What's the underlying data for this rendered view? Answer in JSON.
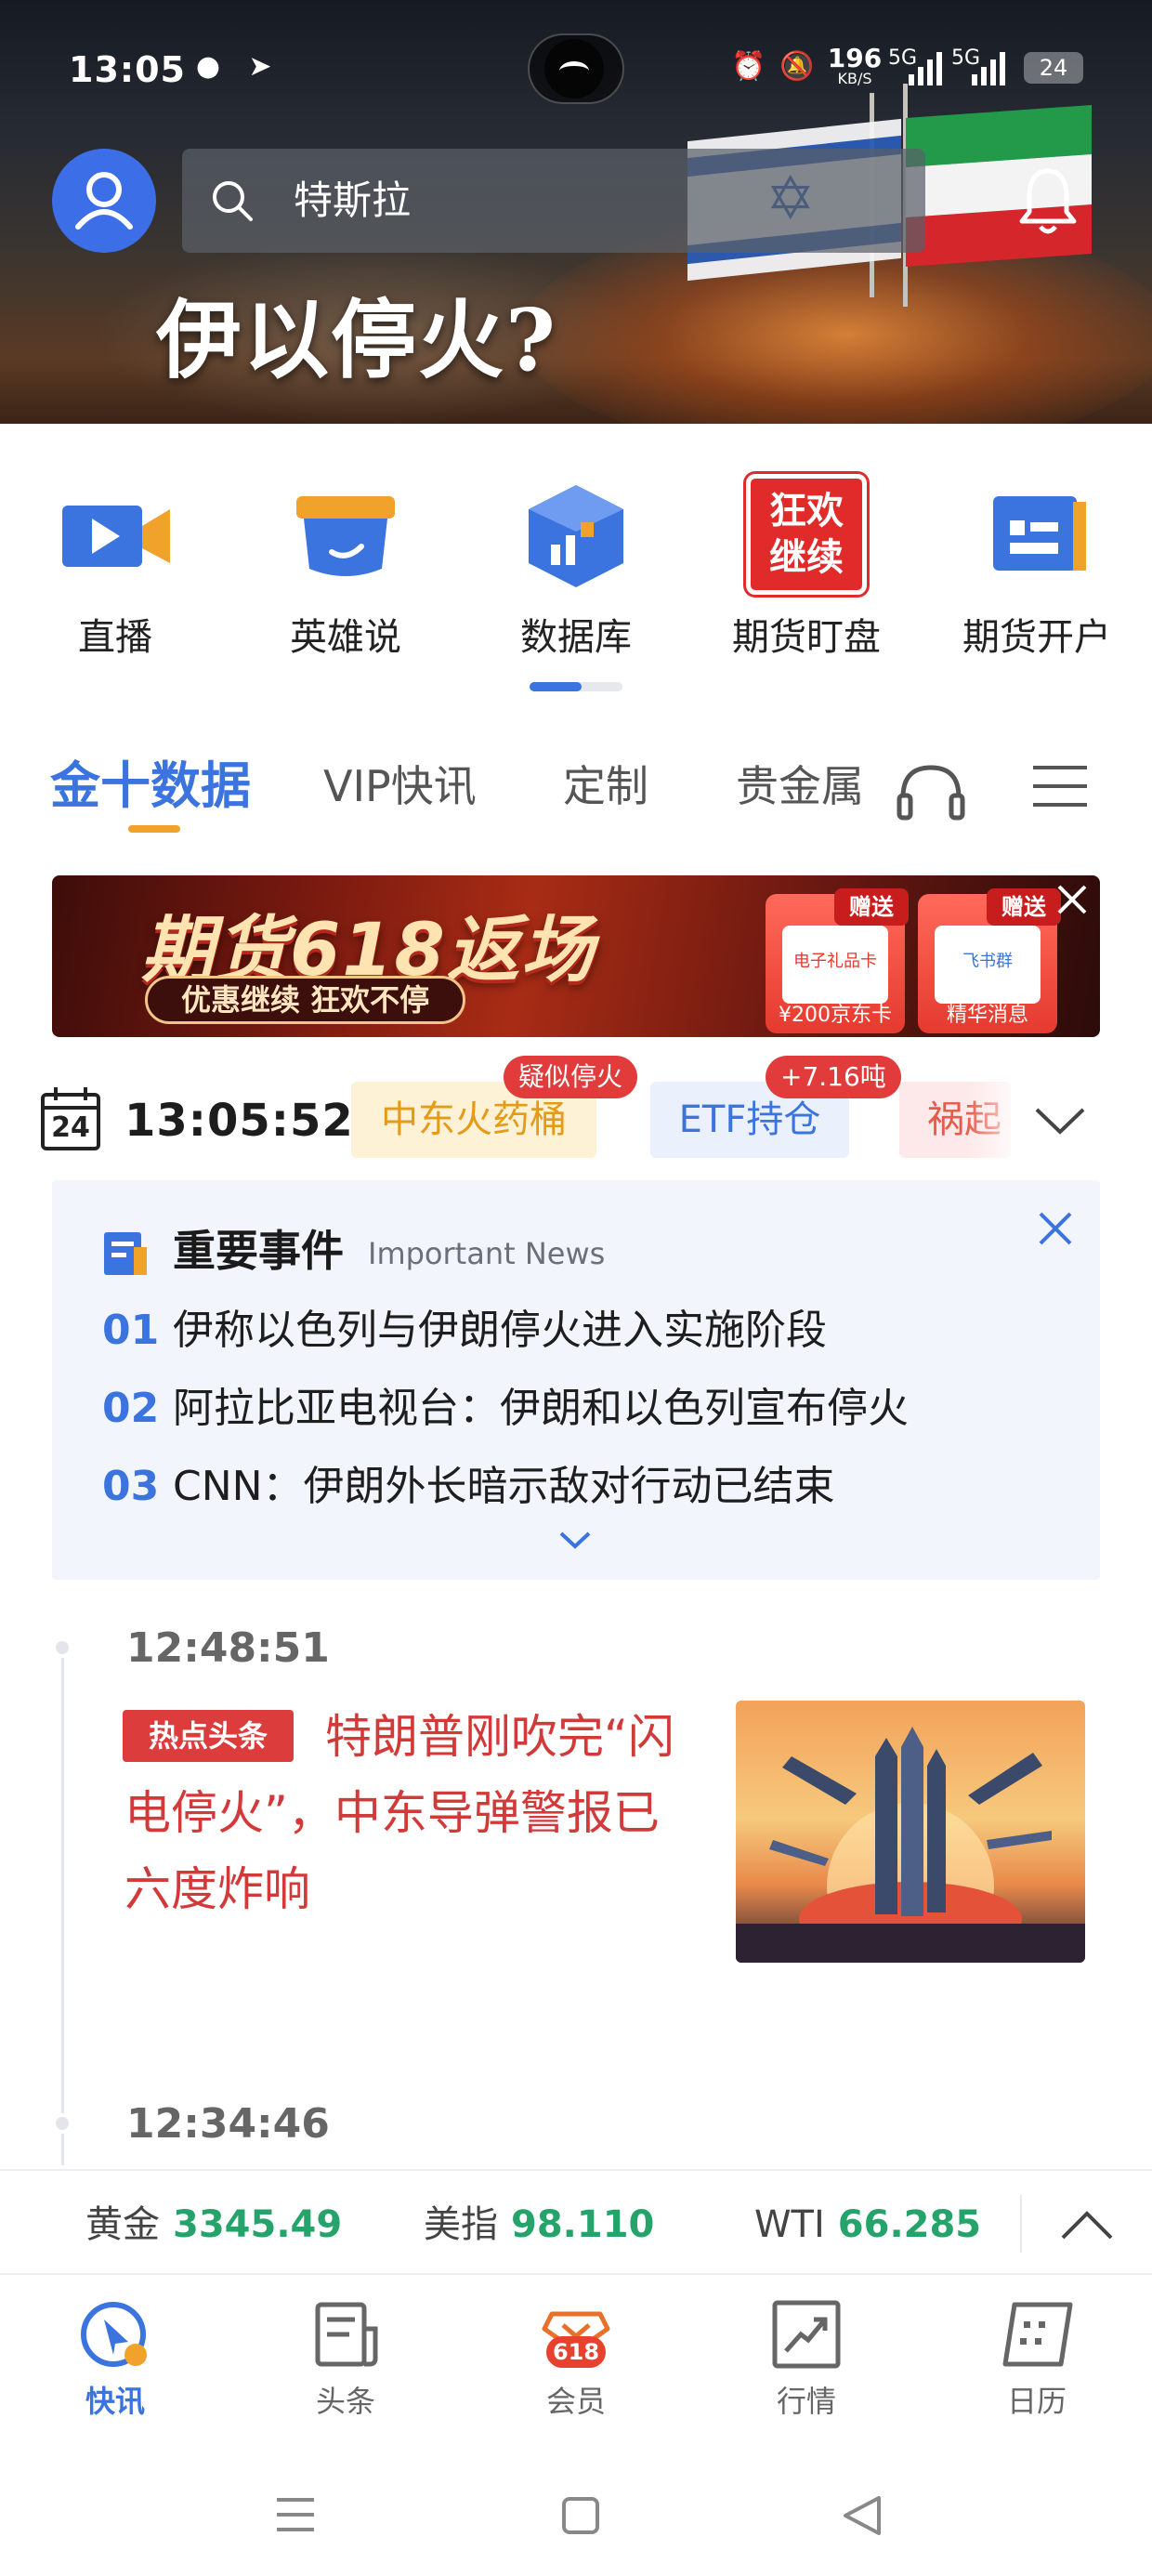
{
  "status_bar": {
    "time": "13:05",
    "net_speed_value": "196",
    "net_speed_unit": "KB/S",
    "signal_1": "5G",
    "signal_2": "5G",
    "battery": "24"
  },
  "header": {
    "search_text": "特斯拉",
    "headline": "伊以停火?"
  },
  "quick_entries": [
    {
      "label": "直播",
      "icon": "video-camera-icon"
    },
    {
      "label": "英雄说",
      "icon": "hero-speech-icon"
    },
    {
      "label": "数据库",
      "icon": "database-cube-icon"
    },
    {
      "label": "期货盯盘",
      "icon": "carnival-continue-icon",
      "icon_text_1": "狂欢",
      "icon_text_2": "继续"
    },
    {
      "label": "期货开户",
      "icon": "account-card-icon"
    }
  ],
  "tabs": [
    {
      "label": "金十数据",
      "active": true
    },
    {
      "label": "VIP快讯"
    },
    {
      "label": "定制"
    },
    {
      "label": "贵金属"
    }
  ],
  "banner": {
    "title": "期货618返场",
    "subtitle": "优惠继续 狂欢不停",
    "gift_1": {
      "tag": "赠送",
      "card": "电子礼品卡",
      "caption": "¥200京东卡"
    },
    "gift_2": {
      "tag": "赠送",
      "card": "飞书群",
      "caption": "精华消息"
    }
  },
  "ticker": {
    "calendar_day": "24",
    "clock": "13:05:52",
    "chips": [
      {
        "label": "中东火药桶",
        "badge": "疑似停火"
      },
      {
        "label": "ETF持仓",
        "badge": "+7.16吨"
      },
      {
        "label": "祸起"
      }
    ]
  },
  "important_news": {
    "title": "重要事件",
    "title_en": "Important News",
    "items": [
      {
        "num": "01",
        "text": "伊称以色列与伊朗停火进入实施阶段"
      },
      {
        "num": "02",
        "text": "阿拉比亚电视台：伊朗和以色列宣布停火"
      },
      {
        "num": "03",
        "text": "CNN：伊朗外长暗示敌对行动已结束"
      }
    ]
  },
  "feed": [
    {
      "time": "12:48:51",
      "tag": "热点头条",
      "headline": "特朗普刚吹完“闪电停火”，中东导弹警报已六度炸响"
    },
    {
      "time": "12:34:46"
    }
  ],
  "prices": [
    {
      "name": "黄金",
      "value": "3345.49"
    },
    {
      "name": "美指",
      "value": "98.110"
    },
    {
      "name": "WTI",
      "value": "66.285"
    }
  ],
  "bottom_nav": [
    {
      "label": "快讯",
      "active": true
    },
    {
      "label": "头条"
    },
    {
      "label": "会员",
      "badge": "618"
    },
    {
      "label": "行情"
    },
    {
      "label": "日历"
    }
  ],
  "colors": {
    "accent": "#3b74de",
    "alert_red": "#dc3c3c",
    "price_green": "#25a36b",
    "tab_underline": "#f0a22a"
  }
}
